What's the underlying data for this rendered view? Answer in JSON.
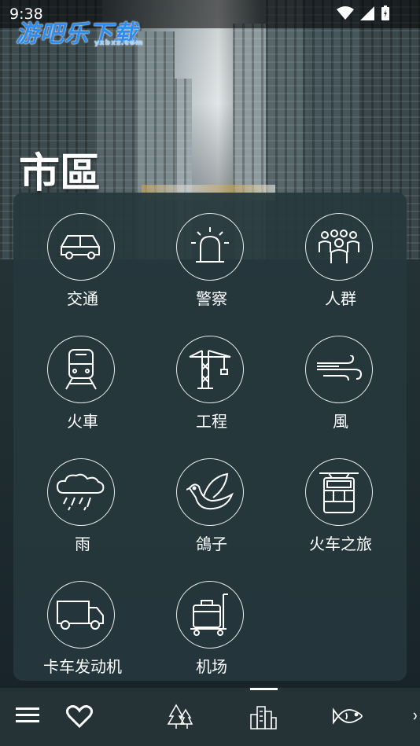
{
  "status_bar": {
    "time": "9:38"
  },
  "watermark": {
    "text": "游吧乐下载",
    "sub": "yxbxz.com"
  },
  "page": {
    "title": "市區"
  },
  "sounds": [
    {
      "label": "交通",
      "icon": "car-icon"
    },
    {
      "label": "警察",
      "icon": "siren-icon"
    },
    {
      "label": "人群",
      "icon": "crowd-icon"
    },
    {
      "label": "火車",
      "icon": "train-icon"
    },
    {
      "label": "工程",
      "icon": "crane-icon"
    },
    {
      "label": "風",
      "icon": "wind-icon"
    },
    {
      "label": "雨",
      "icon": "rain-cloud-icon"
    },
    {
      "label": "鴿子",
      "icon": "pigeon-icon"
    },
    {
      "label": "火车之旅",
      "icon": "train-journey-icon"
    },
    {
      "label": "卡车发动机",
      "icon": "truck-icon"
    },
    {
      "label": "机场",
      "icon": "luggage-cart-icon"
    }
  ],
  "bottom_nav": {
    "items": [
      "menu-icon",
      "heart-icon",
      "forest-icon",
      "city-icon",
      "fish-icon"
    ],
    "active": "city-icon"
  }
}
